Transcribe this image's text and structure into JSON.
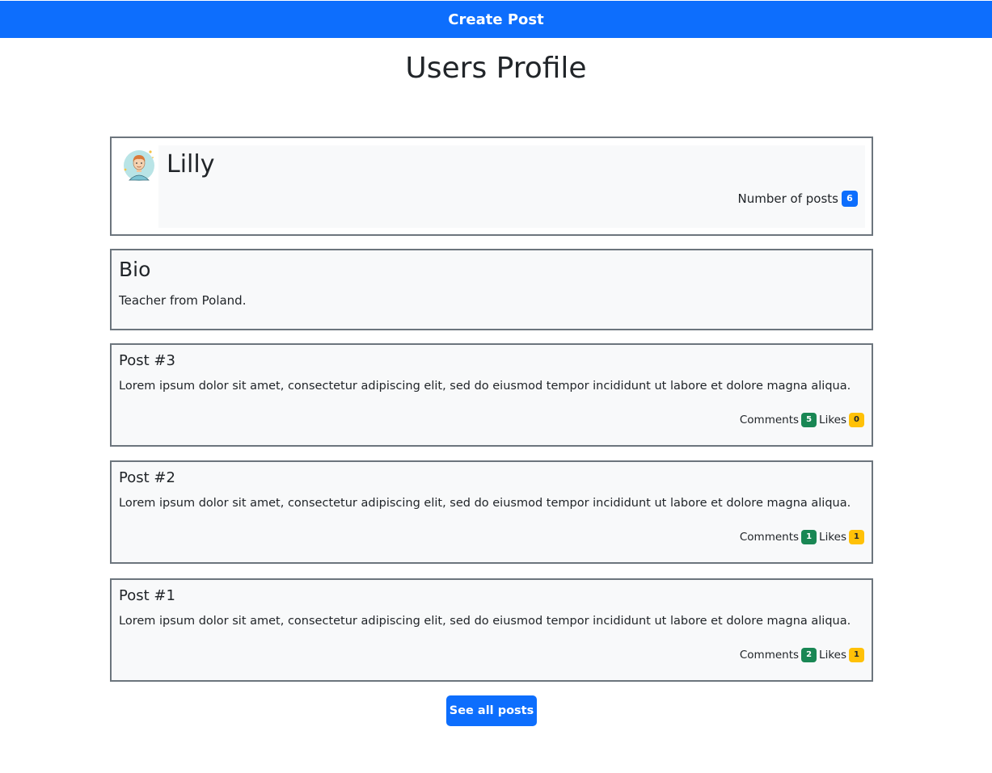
{
  "topbar": {
    "create_label": "Create Post",
    "color": "#0d6efd"
  },
  "page": {
    "title": "Users Profile"
  },
  "profile": {
    "name": "Lilly",
    "posts_label": "Number of posts",
    "posts_count": "6",
    "avatar_icon": "user-avatar-icon"
  },
  "bio": {
    "title": "Bio",
    "text": "Teacher from Poland."
  },
  "posts": [
    {
      "title": "Post #3",
      "text": "Lorem ipsum dolor sit amet, consectetur adipiscing elit, sed do eiusmod tempor incididunt ut labore et dolore magna aliqua.",
      "comments_label": "Comments",
      "comments": "5",
      "likes_label": "Likes",
      "likes": "0"
    },
    {
      "title": "Post #2",
      "text": "Lorem ipsum dolor sit amet, consectetur adipiscing elit, sed do eiusmod tempor incididunt ut labore et dolore magna aliqua.",
      "comments_label": "Comments",
      "comments": "1",
      "likes_label": "Likes",
      "likes": "1"
    },
    {
      "title": "Post #1",
      "text": "Lorem ipsum dolor sit amet, consectetur adipiscing elit, sed do eiusmod tempor incididunt ut labore et dolore magna aliqua.",
      "comments_label": "Comments",
      "comments": "2",
      "likes_label": "Likes",
      "likes": "1"
    }
  ],
  "footer": {
    "see_all_label": "See all posts"
  },
  "colors": {
    "primary": "#0d6efd",
    "success": "#198754",
    "warning": "#ffc107",
    "card_border": "#6c757d"
  }
}
